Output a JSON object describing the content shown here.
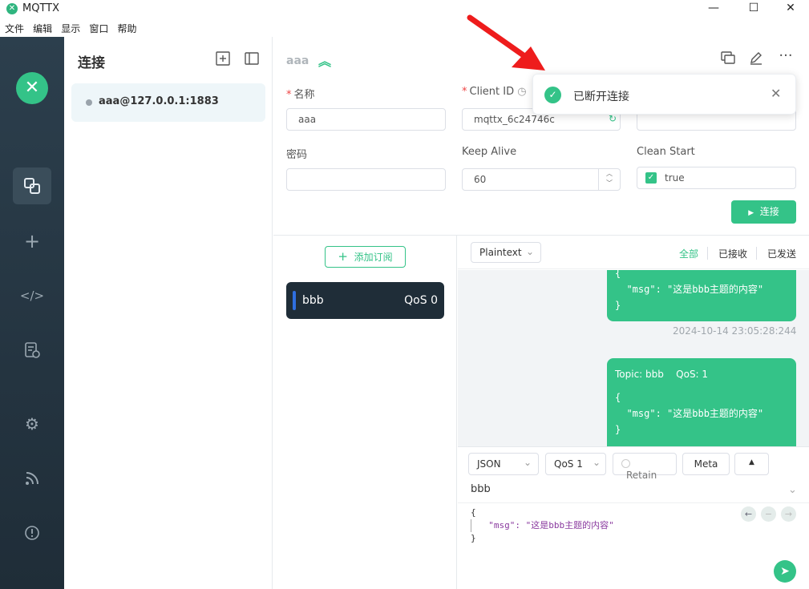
{
  "window": {
    "title": "MQTTX",
    "minimize": "—",
    "maximize": "☐",
    "close": "✕"
  },
  "menu": [
    "文件",
    "编辑",
    "显示",
    "窗口",
    "帮助"
  ],
  "sidebar": {
    "items": [
      {
        "name": "connections-icon",
        "active": true
      },
      {
        "name": "new-connection-icon",
        "active": false
      },
      {
        "name": "script-icon",
        "active": false
      },
      {
        "name": "log-icon",
        "active": false
      },
      {
        "name": "settings-icon",
        "active": false
      },
      {
        "name": "subscribe-feed-icon",
        "active": false
      },
      {
        "name": "about-icon",
        "active": false
      }
    ]
  },
  "connections": {
    "heading": "连接",
    "items": [
      {
        "name": "aaa@127.0.0.1:1883",
        "status_color": "#9aa3ab"
      }
    ]
  },
  "main": {
    "title": "aaa",
    "form": {
      "name_label": "名称",
      "name_value": "aaa",
      "client_id_label": "Client ID",
      "client_id_value": "mqttx_6c24746c",
      "password_label": "密码",
      "password_value": "",
      "keepalive_label": "Keep Alive",
      "keepalive_value": "60",
      "clean_start_label": "Clean Start",
      "clean_start_value": "true"
    },
    "connect_button": "连接"
  },
  "subscriptions": {
    "add_button": "添加订阅",
    "items": [
      {
        "topic": "bbb",
        "qos": "QoS 0",
        "color": "#2f6fe0"
      }
    ]
  },
  "messages": {
    "format": "Plaintext",
    "filters": [
      "全部",
      "已接收",
      "已发送"
    ],
    "active_filter": "全部",
    "list": [
      {
        "payload_lines": [
          "{",
          "  \"msg\": \"这是bbb主题的内容\"",
          "}"
        ],
        "time": "2024-10-14 23:05:28:244"
      },
      {
        "topic_meta": "Topic: bbb",
        "qos_meta": "QoS: 1",
        "payload_lines": [
          "{",
          "  \"msg\": \"这是bbb主题的内容\"",
          "}"
        ]
      }
    ]
  },
  "publish": {
    "payload_type": "JSON",
    "qos": "QoS 1",
    "retain_label": "Retain",
    "meta_label": "Meta",
    "topic": "bbb",
    "payload_lines": [
      "{",
      "  \"msg\": \"这是bbb主题的内容\"",
      "}"
    ]
  },
  "toast": {
    "message": "已断开连接",
    "color": "#34c388"
  },
  "colors": {
    "accent": "#34c388",
    "sidebar_bg": "#1f2d38",
    "annotation_arrow": "#ee1c1c"
  }
}
